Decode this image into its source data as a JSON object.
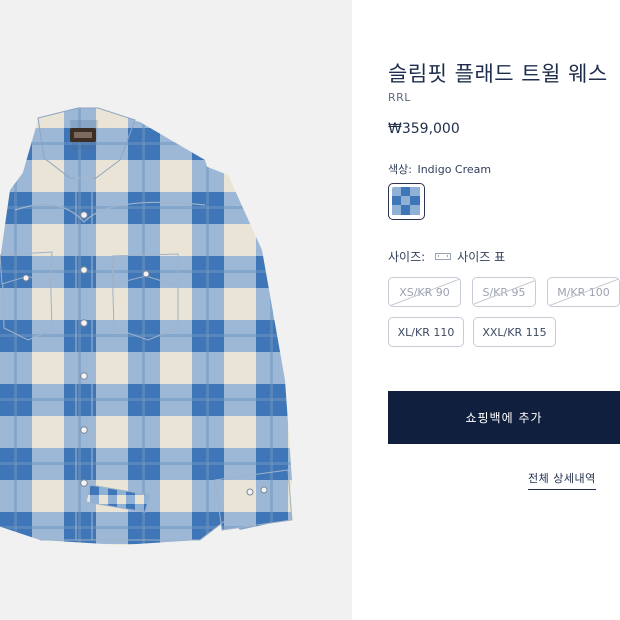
{
  "product": {
    "title": "슬림핏 플래드 트윌 웨스",
    "brand": "RRL",
    "price": "₩359,000",
    "image_alt": "indigo cream plaid western shirt"
  },
  "color": {
    "label": "색상:",
    "value": "Indigo Cream"
  },
  "size": {
    "label": "사이즈:",
    "chart_link": "사이즈 표",
    "options": [
      {
        "label": "XS/KR 90",
        "available": false
      },
      {
        "label": "S/KR 95",
        "available": false
      },
      {
        "label": "M/KR 100",
        "available": false
      },
      {
        "label": "XL/KR 110",
        "available": true
      },
      {
        "label": "XXL/KR 115",
        "available": true
      }
    ]
  },
  "actions": {
    "add_to_bag": "쇼핑백에 추가",
    "full_details": "전체 상세내역"
  },
  "colors": {
    "navy": "#0f1f3d",
    "plaid_blue": "#4a7ebd",
    "plaid_cream": "#ece7da"
  }
}
